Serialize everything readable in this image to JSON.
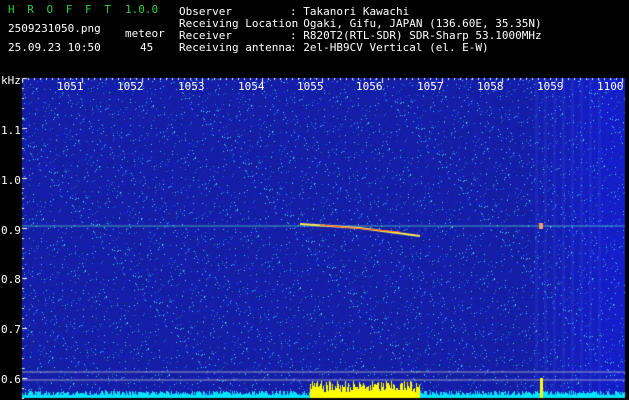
{
  "app": {
    "name": "H R O F F T",
    "version": "1.0.0"
  },
  "file": {
    "name": "2509231050.png",
    "datetime": "25.09.23 10:50"
  },
  "meteor": {
    "label": "meteor",
    "count": "45"
  },
  "info": [
    {
      "key": "Observer",
      "value": ": Takanori Kawachi"
    },
    {
      "key": "Receiving Location",
      "value": ": Ogaki, Gifu, JAPAN (136.60E, 35.35N)"
    },
    {
      "key": "Receiver",
      "value": ": R820T2(RTL-SDR) SDR-Sharp 53.1000MHz"
    },
    {
      "key": "Receiving antenna",
      "value": ": 2el-HB9CV Vertical (el. E-W)"
    }
  ],
  "axis": {
    "unit": "kHz",
    "time_labels": [
      "1051",
      "1052",
      "1053",
      "1054",
      "1055",
      "1056",
      "1057",
      "1058",
      "1059",
      "1100"
    ],
    "freq_labels": [
      "1.1",
      "1.0",
      "0.9",
      "0.8",
      "0.7",
      "0.6"
    ]
  },
  "colors": {
    "background": "#1a1a8c",
    "header_green": "#2ecc40",
    "signal_line": "#66ffcc",
    "bottom_bar": "#00e5ff",
    "meteor_bar": "#ffff00"
  }
}
